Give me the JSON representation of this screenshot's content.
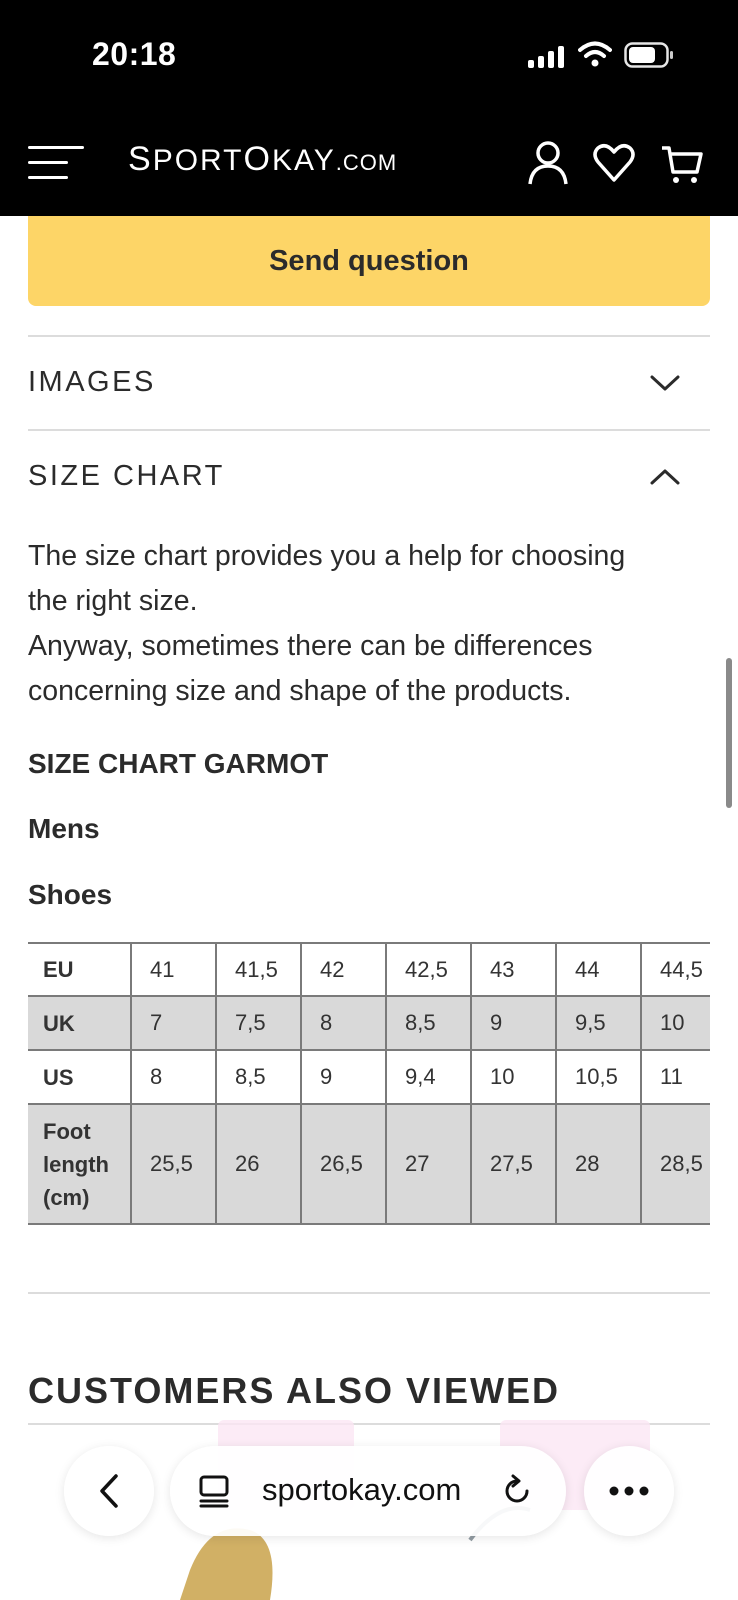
{
  "status_bar": {
    "time": "20:18"
  },
  "header": {
    "logo": {
      "part1": "S",
      "part2": "PORT",
      "part3": "O",
      "part4": "KAY",
      "part5": ".COM"
    }
  },
  "question": {
    "send_label": "Send question"
  },
  "accordions": [
    {
      "title": "IMAGES",
      "expanded": false
    },
    {
      "title": "SIZE CHART",
      "expanded": true
    }
  ],
  "size_chart": {
    "description": [
      "The size chart provides you a help for choosing",
      "the right size.",
      "Anyway, sometimes there can be differences",
      "concerning size and shape of the products."
    ],
    "heading": "SIZE CHART GARMOT",
    "group": "Mens",
    "category": "Shoes",
    "rows": [
      {
        "label": "EU",
        "values": [
          "41",
          "41,5",
          "42",
          "42,5",
          "43",
          "44",
          "44,5"
        ]
      },
      {
        "label": "UK",
        "values": [
          "7",
          "7,5",
          "8",
          "8,5",
          "9",
          "9,5",
          "10"
        ]
      },
      {
        "label": "US",
        "values": [
          "8",
          "8,5",
          "9",
          "9,4",
          "10",
          "10,5",
          "11"
        ]
      },
      {
        "label": "Foot length (cm)",
        "values": [
          "25,5",
          "26",
          "26,5",
          "27",
          "27,5",
          "28",
          "28,5"
        ]
      }
    ]
  },
  "related": {
    "title": "CUSTOMERS ALSO VIEWED"
  },
  "browser": {
    "url": "sportokay.com"
  },
  "colors": {
    "accent": "#fdd567",
    "header_bg": "#000000",
    "table_shade": "#d9d9d9"
  },
  "icons": [
    "signal-icon",
    "wifi-icon",
    "battery-icon",
    "menu-icon",
    "account-icon",
    "heart-icon",
    "cart-icon",
    "chevron-down-icon",
    "chevron-up-icon",
    "back-icon",
    "tabs-icon",
    "reload-icon",
    "more-icon"
  ]
}
